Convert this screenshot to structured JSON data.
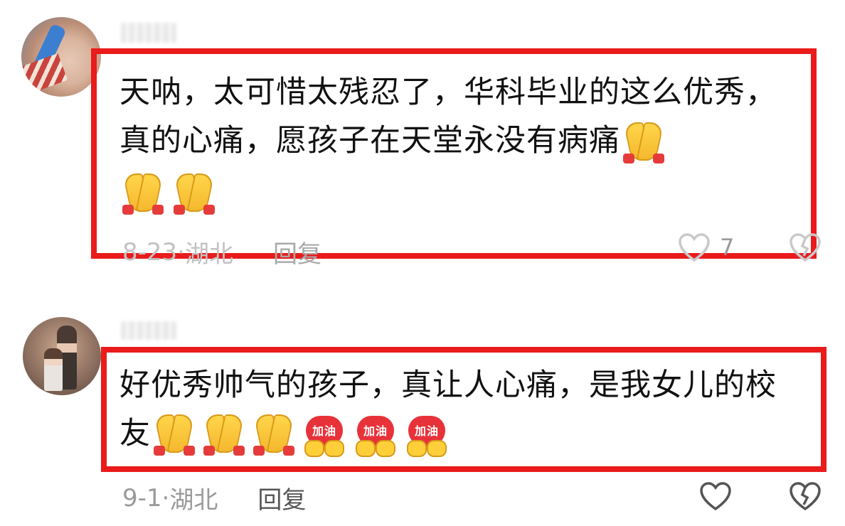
{
  "comments": [
    {
      "text": "天呐，太可惜太残忍了，华科毕业的这么优秀，真的心痛，愿孩子在天堂永没有病痛",
      "date": "8-23",
      "location": "湖北",
      "reply_label": "回复",
      "like_count": "7",
      "emoji": [
        "pray-emoji",
        "pray-emoji",
        "pray-emoji"
      ]
    },
    {
      "text": "好优秀帅气的孩子，真让人心痛，是我女儿的校友",
      "date": "9-1",
      "location": "湖北",
      "reply_label": "回复",
      "emoji": [
        "pray-emoji",
        "pray-emoji",
        "pray-emoji",
        "jiayou-emoji",
        "jiayou-emoji",
        "jiayou-emoji"
      ],
      "jiayou_text": "加油"
    }
  ],
  "meta_separator": "·",
  "colors": {
    "highlight_border": "#ea1b1b",
    "text": "#111111",
    "meta": "#9a9a9a"
  }
}
